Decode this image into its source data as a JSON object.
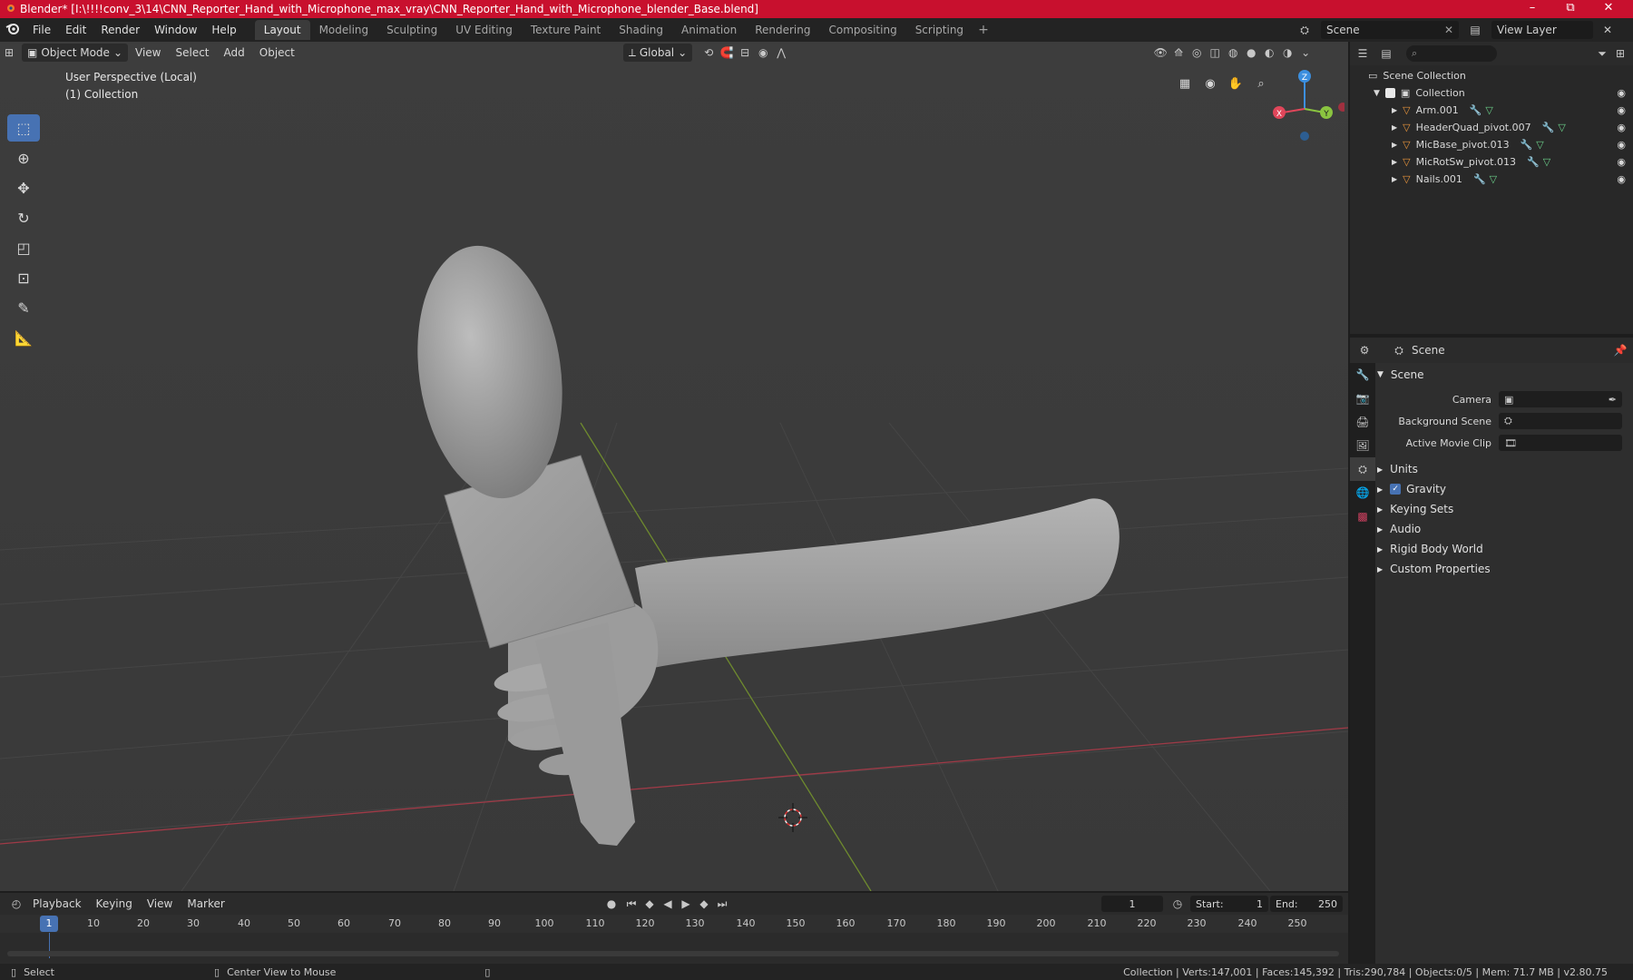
{
  "window": {
    "title": "Blender* [I:\\!!!!conv_3\\14\\CNN_Reporter_Hand_with_Microphone_max_vray\\CNN_Reporter_Hand_with_Microphone_blender_Base.blend]",
    "minimize": "–",
    "maximize": "⧉",
    "close": "✕"
  },
  "menubar": {
    "items": [
      "File",
      "Edit",
      "Render",
      "Window",
      "Help"
    ],
    "workspaces": [
      "Layout",
      "Modeling",
      "Sculpting",
      "UV Editing",
      "Texture Paint",
      "Shading",
      "Animation",
      "Rendering",
      "Compositing",
      "Scripting"
    ],
    "active_workspace": "Layout",
    "add_tab": "+",
    "scene": "Scene",
    "view_layer": "View Layer"
  },
  "viewport": {
    "mode": "Object Mode",
    "menus": [
      "View",
      "Select",
      "Add",
      "Object"
    ],
    "orientation": "Global",
    "perspective_label": "User Perspective (Local)",
    "collection_label": "(1) Collection",
    "gizmo": {
      "x": "X",
      "y": "Y",
      "z": "Z"
    }
  },
  "outliner": {
    "root": "Scene Collection",
    "collection": "Collection",
    "objects": [
      "Arm.001",
      "HeaderQuad_pivot.007",
      "MicBase_pivot.013",
      "MicRotSw_pivot.013",
      "Nails.001"
    ]
  },
  "properties": {
    "context": "Scene",
    "panel_title": "Scene",
    "fields": [
      {
        "label": "Camera",
        "value": ""
      },
      {
        "label": "Background Scene",
        "value": ""
      },
      {
        "label": "Active Movie Clip",
        "value": ""
      }
    ],
    "sections": [
      "Units",
      "Gravity",
      "Keying Sets",
      "Audio",
      "Rigid Body World",
      "Custom Properties"
    ],
    "gravity_checked": true
  },
  "timeline": {
    "menus": [
      "Playback",
      "Keying",
      "View",
      "Marker"
    ],
    "current_frame": "1",
    "start_label": "Start:",
    "start": "1",
    "end_label": "End:",
    "end": "250",
    "ticks": [
      "1",
      "10",
      "20",
      "30",
      "40",
      "50",
      "60",
      "70",
      "80",
      "90",
      "100",
      "110",
      "120",
      "130",
      "140",
      "150",
      "160",
      "170",
      "180",
      "190",
      "200",
      "210",
      "220",
      "230",
      "240",
      "250"
    ]
  },
  "statusbar": {
    "left_action": "Select",
    "middle_action": "Center View to Mouse",
    "stats": "Collection | Verts:147,001 | Faces:145,392 | Tris:290,784 | Objects:0/5 | Mem: 71.7 MB | v2.80.75"
  },
  "colors": {
    "title_bar": "#c8102e",
    "accent": "#4772b3",
    "x_axis": "#e0465a",
    "y_axis": "#8ac440",
    "z_axis": "#3c8fdf"
  }
}
